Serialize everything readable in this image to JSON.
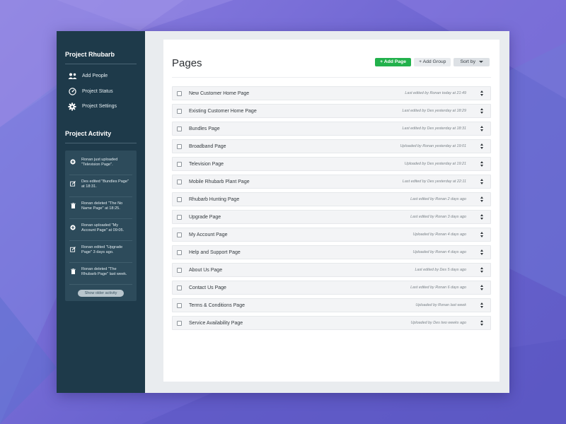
{
  "colors": {
    "sidebar_bg": "#1e3a4a",
    "accent_green": "#22b14c",
    "background_purple": "#6a63cf"
  },
  "sidebar": {
    "project_title": "Project Rhubarb",
    "nav": [
      {
        "label": "Add People",
        "icon": "people-icon"
      },
      {
        "label": "Project Status",
        "icon": "dashboard-icon"
      },
      {
        "label": "Project Settings",
        "icon": "gear-icon"
      }
    ],
    "activity_title": "Project Activity",
    "activity": [
      {
        "icon": "plus-circle-icon",
        "text": "Ronan just uploaded \"Television Page\"."
      },
      {
        "icon": "edit-icon",
        "text": "Des edited \"Bundles Page\" at 18:31."
      },
      {
        "icon": "trash-icon",
        "text": "Ronan deleted \"The No Name Page\" at 18:25."
      },
      {
        "icon": "plus-circle-icon",
        "text": "Ronan uploaded \"My Account Page\" at 09:05."
      },
      {
        "icon": "edit-icon",
        "text": "Ronan edited \"Upgrade Page\" 3 days ago."
      },
      {
        "icon": "trash-icon",
        "text": "Ronan deleted \"The Rhubarb Page\" last week."
      }
    ],
    "older_button": "Show older activity"
  },
  "main": {
    "title": "Pages",
    "add_page": "+ Add Page",
    "add_group": "+ Add Group",
    "sort_by": "Sort by"
  },
  "pages": [
    {
      "name": "New Customer Home Page",
      "meta": "Last edited by Ronan today at 21:49"
    },
    {
      "name": "Existing Customer Home Page",
      "meta": "Last edited by Des yesterday at 18:29"
    },
    {
      "name": "Bundles Page",
      "meta": "Last edited by Des yesterday at 18:31"
    },
    {
      "name": "Broadband Page",
      "meta": "Uploaded by Ronan yesterday at 19:01"
    },
    {
      "name": "Television Page",
      "meta": "Uploaded by Des yesterday at 19:21"
    },
    {
      "name": "Mobile Rhubarb Plant Page",
      "meta": "Last edited by Des yesterday at 22:11"
    },
    {
      "name": "Rhubarb Hunting Page",
      "meta": "Last edited by Ronan 2 days ago"
    },
    {
      "name": "Upgrade Page",
      "meta": "Last edited by Ronan 3 days ago"
    },
    {
      "name": "My Account Page",
      "meta": "Uploaded by Ronan 4 days ago"
    },
    {
      "name": "Help and Support Page",
      "meta": "Uploaded by Ronan 4 days ago"
    },
    {
      "name": "About Us Page",
      "meta": "Last edited by Des 5 days ago"
    },
    {
      "name": "Contact Us Page",
      "meta": "Last edited by Ronan 6 days ago"
    },
    {
      "name": "Terms & Conditions Page",
      "meta": "Uploaded by Ronan last week"
    },
    {
      "name": "Service Availability Page",
      "meta": "Uploaded by Des two weeks ago"
    }
  ]
}
